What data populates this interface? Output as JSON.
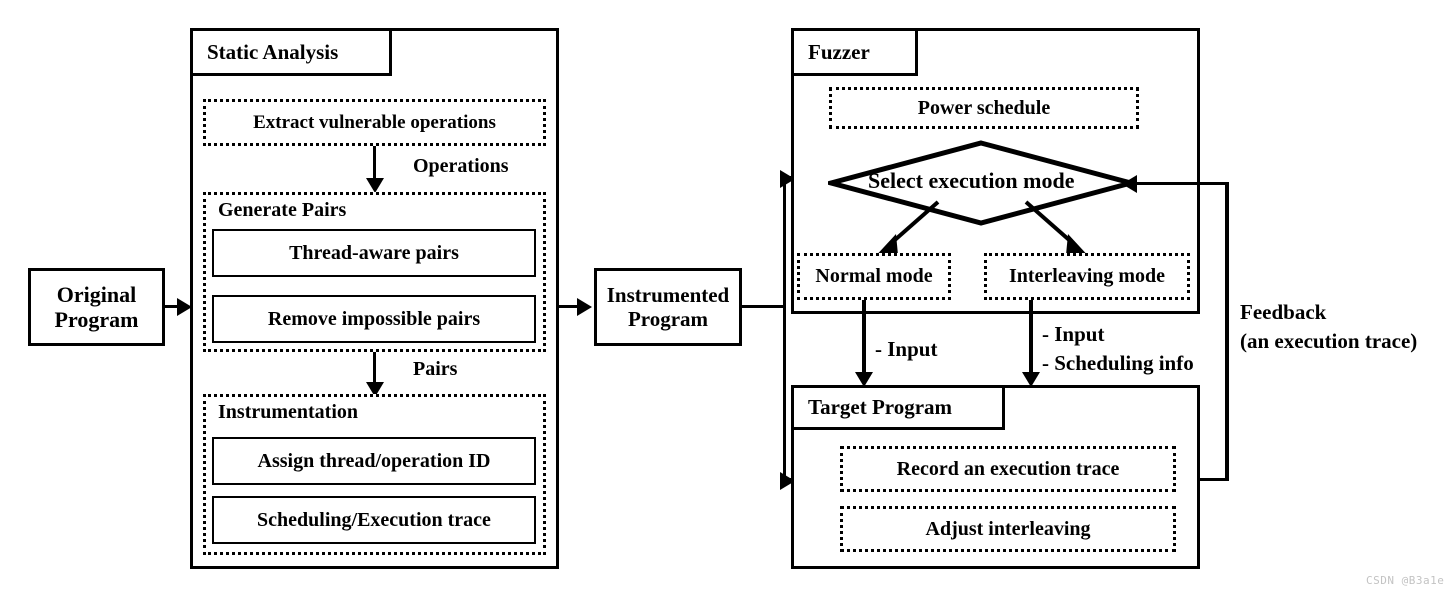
{
  "figure": {
    "watermark": "CSDN @B3a1e"
  },
  "left_input": {
    "label_line1": "Original",
    "label_line2": "Program"
  },
  "static_analysis": {
    "title": "Static Analysis",
    "extract_label": "Extract vulnerable operations",
    "edge_operations_label": "Operations",
    "generate_pairs": {
      "title": "Generate Pairs",
      "items": [
        "Thread-aware pairs",
        "Remove impossible pairs"
      ]
    },
    "edge_pairs_label": "Pairs",
    "instrumentation": {
      "title": "Instrumentation",
      "items": [
        "Assign thread/operation ID",
        "Scheduling/Execution trace"
      ]
    }
  },
  "middle": {
    "label_line1": "Instrumented",
    "label_line2": "Program"
  },
  "fuzzer": {
    "title": "Fuzzer",
    "power_schedule": "Power schedule",
    "decision": "Select execution mode",
    "modes": [
      "Normal mode",
      "Interleaving mode"
    ]
  },
  "edges": {
    "normal_input": "- Input",
    "interleaving_input": "- Input",
    "interleaving_sched": "- Scheduling info",
    "feedback_line1": "Feedback",
    "feedback_line2": "(an execution trace)"
  },
  "target_program": {
    "title": "Target Program",
    "items": [
      "Record an execution trace",
      "Adjust interleaving"
    ]
  }
}
